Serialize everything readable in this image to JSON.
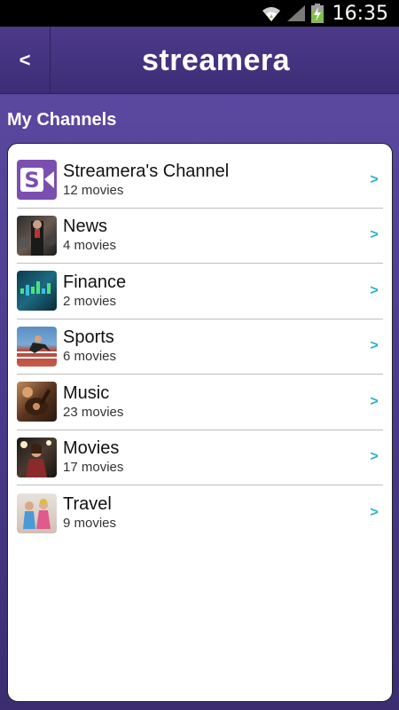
{
  "status_bar": {
    "time": "16:35"
  },
  "header": {
    "back_label": "<",
    "title": "streamera"
  },
  "section": {
    "title": "My Channels"
  },
  "channels": [
    {
      "name": "Streamera's Channel",
      "count": "12 movies",
      "icon": "streamera-logo-icon",
      "color": "#7b4fb0"
    },
    {
      "name": "News",
      "count": "4 movies",
      "icon": "news-thumbnail",
      "color": "#3b3b3b"
    },
    {
      "name": "Finance",
      "count": "2 movies",
      "icon": "finance-thumbnail",
      "color": "#1c5a6e"
    },
    {
      "name": "Sports",
      "count": "6 movies",
      "icon": "sports-thumbnail",
      "color": "#4a7fae"
    },
    {
      "name": "Music",
      "count": "23 movies",
      "icon": "music-thumbnail",
      "color": "#7a4a2a"
    },
    {
      "name": "Movies",
      "count": "17 movies",
      "icon": "movies-thumbnail",
      "color": "#5a3f2a"
    },
    {
      "name": "Travel",
      "count": "9 movies",
      "icon": "travel-thumbnail",
      "color": "#d9c5b5"
    }
  ],
  "chevron": ">"
}
